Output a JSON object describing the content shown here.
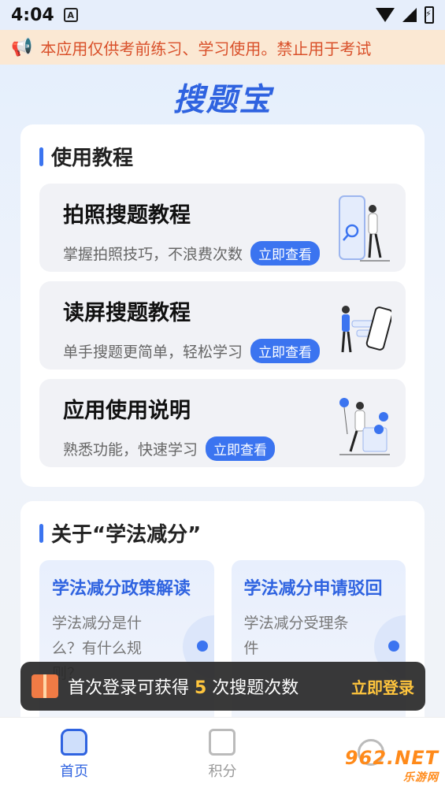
{
  "status": {
    "time": "4:04"
  },
  "notice": {
    "text": "本应用仅供考前练习、学习使用。禁止用于考试"
  },
  "app": {
    "title": "搜题宝"
  },
  "tutorial": {
    "heading": "使用教程",
    "items": [
      {
        "title": "拍照搜题教程",
        "desc": "掌握拍照技巧，不浪费次数",
        "button": "立即查看"
      },
      {
        "title": "读屏搜题教程",
        "desc": "单手搜题更简单，轻松学习",
        "button": "立即查看"
      },
      {
        "title": "应用使用说明",
        "desc": "熟悉功能，快速学习",
        "button": "立即查看"
      }
    ]
  },
  "about": {
    "heading": "关于“学法减分”",
    "items": [
      {
        "title": "学法减分政策解读",
        "desc": "学法减分是什么？有什么规则？"
      },
      {
        "title": "学法减分申请驳回",
        "desc": "学法减分受理条件"
      }
    ]
  },
  "toast": {
    "prefix": "首次登录可获得 ",
    "count": "5",
    "suffix": " 次搜题次数",
    "button": "立即登录"
  },
  "nav": {
    "home": "首页",
    "points": "积分",
    "me": ""
  },
  "watermark": {
    "main": "962.NET",
    "sub": "乐游网"
  }
}
